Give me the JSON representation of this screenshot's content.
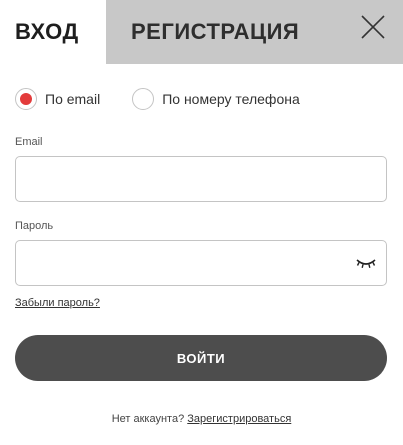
{
  "tabs": {
    "login_label": "ВХОД",
    "register_label": "РЕГИСТРАЦИЯ"
  },
  "close_icon": "close-icon",
  "radios": {
    "email_label": "По email",
    "phone_label": "По номеру телефона",
    "selected": "email"
  },
  "email": {
    "label": "Email",
    "value": "",
    "placeholder": ""
  },
  "password": {
    "label": "Пароль",
    "value": "",
    "placeholder": "",
    "eye_icon": "eye-closed-icon"
  },
  "forgot_label": "Забыли пароль?",
  "submit_label": "ВОЙТИ",
  "footer": {
    "text": "Нет аккаунта?",
    "link": "Зарегистрироваться"
  },
  "colors": {
    "accent": "#e33b3b",
    "button": "#4d4d4d",
    "inactive_tab": "#c8c8c8"
  }
}
